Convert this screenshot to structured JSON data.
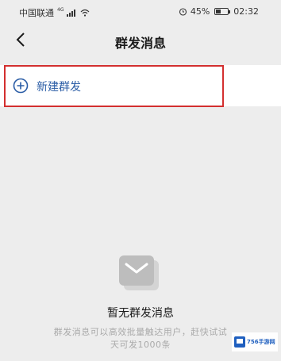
{
  "status_bar": {
    "carrier": "中国联通",
    "network": "4G",
    "battery": "45%",
    "time": "02:32"
  },
  "nav": {
    "title": "群发消息"
  },
  "new_broadcast": {
    "label": "新建群发",
    "highlight_color": "#d32f2f",
    "accent_color": "#2b5da6"
  },
  "empty_state": {
    "title": "暂无群发消息",
    "description_line1": "群发消息可以高效批量触达用户，赶快试试",
    "description_line2": "天可发1000条"
  },
  "watermark": {
    "text": "756手游网"
  }
}
